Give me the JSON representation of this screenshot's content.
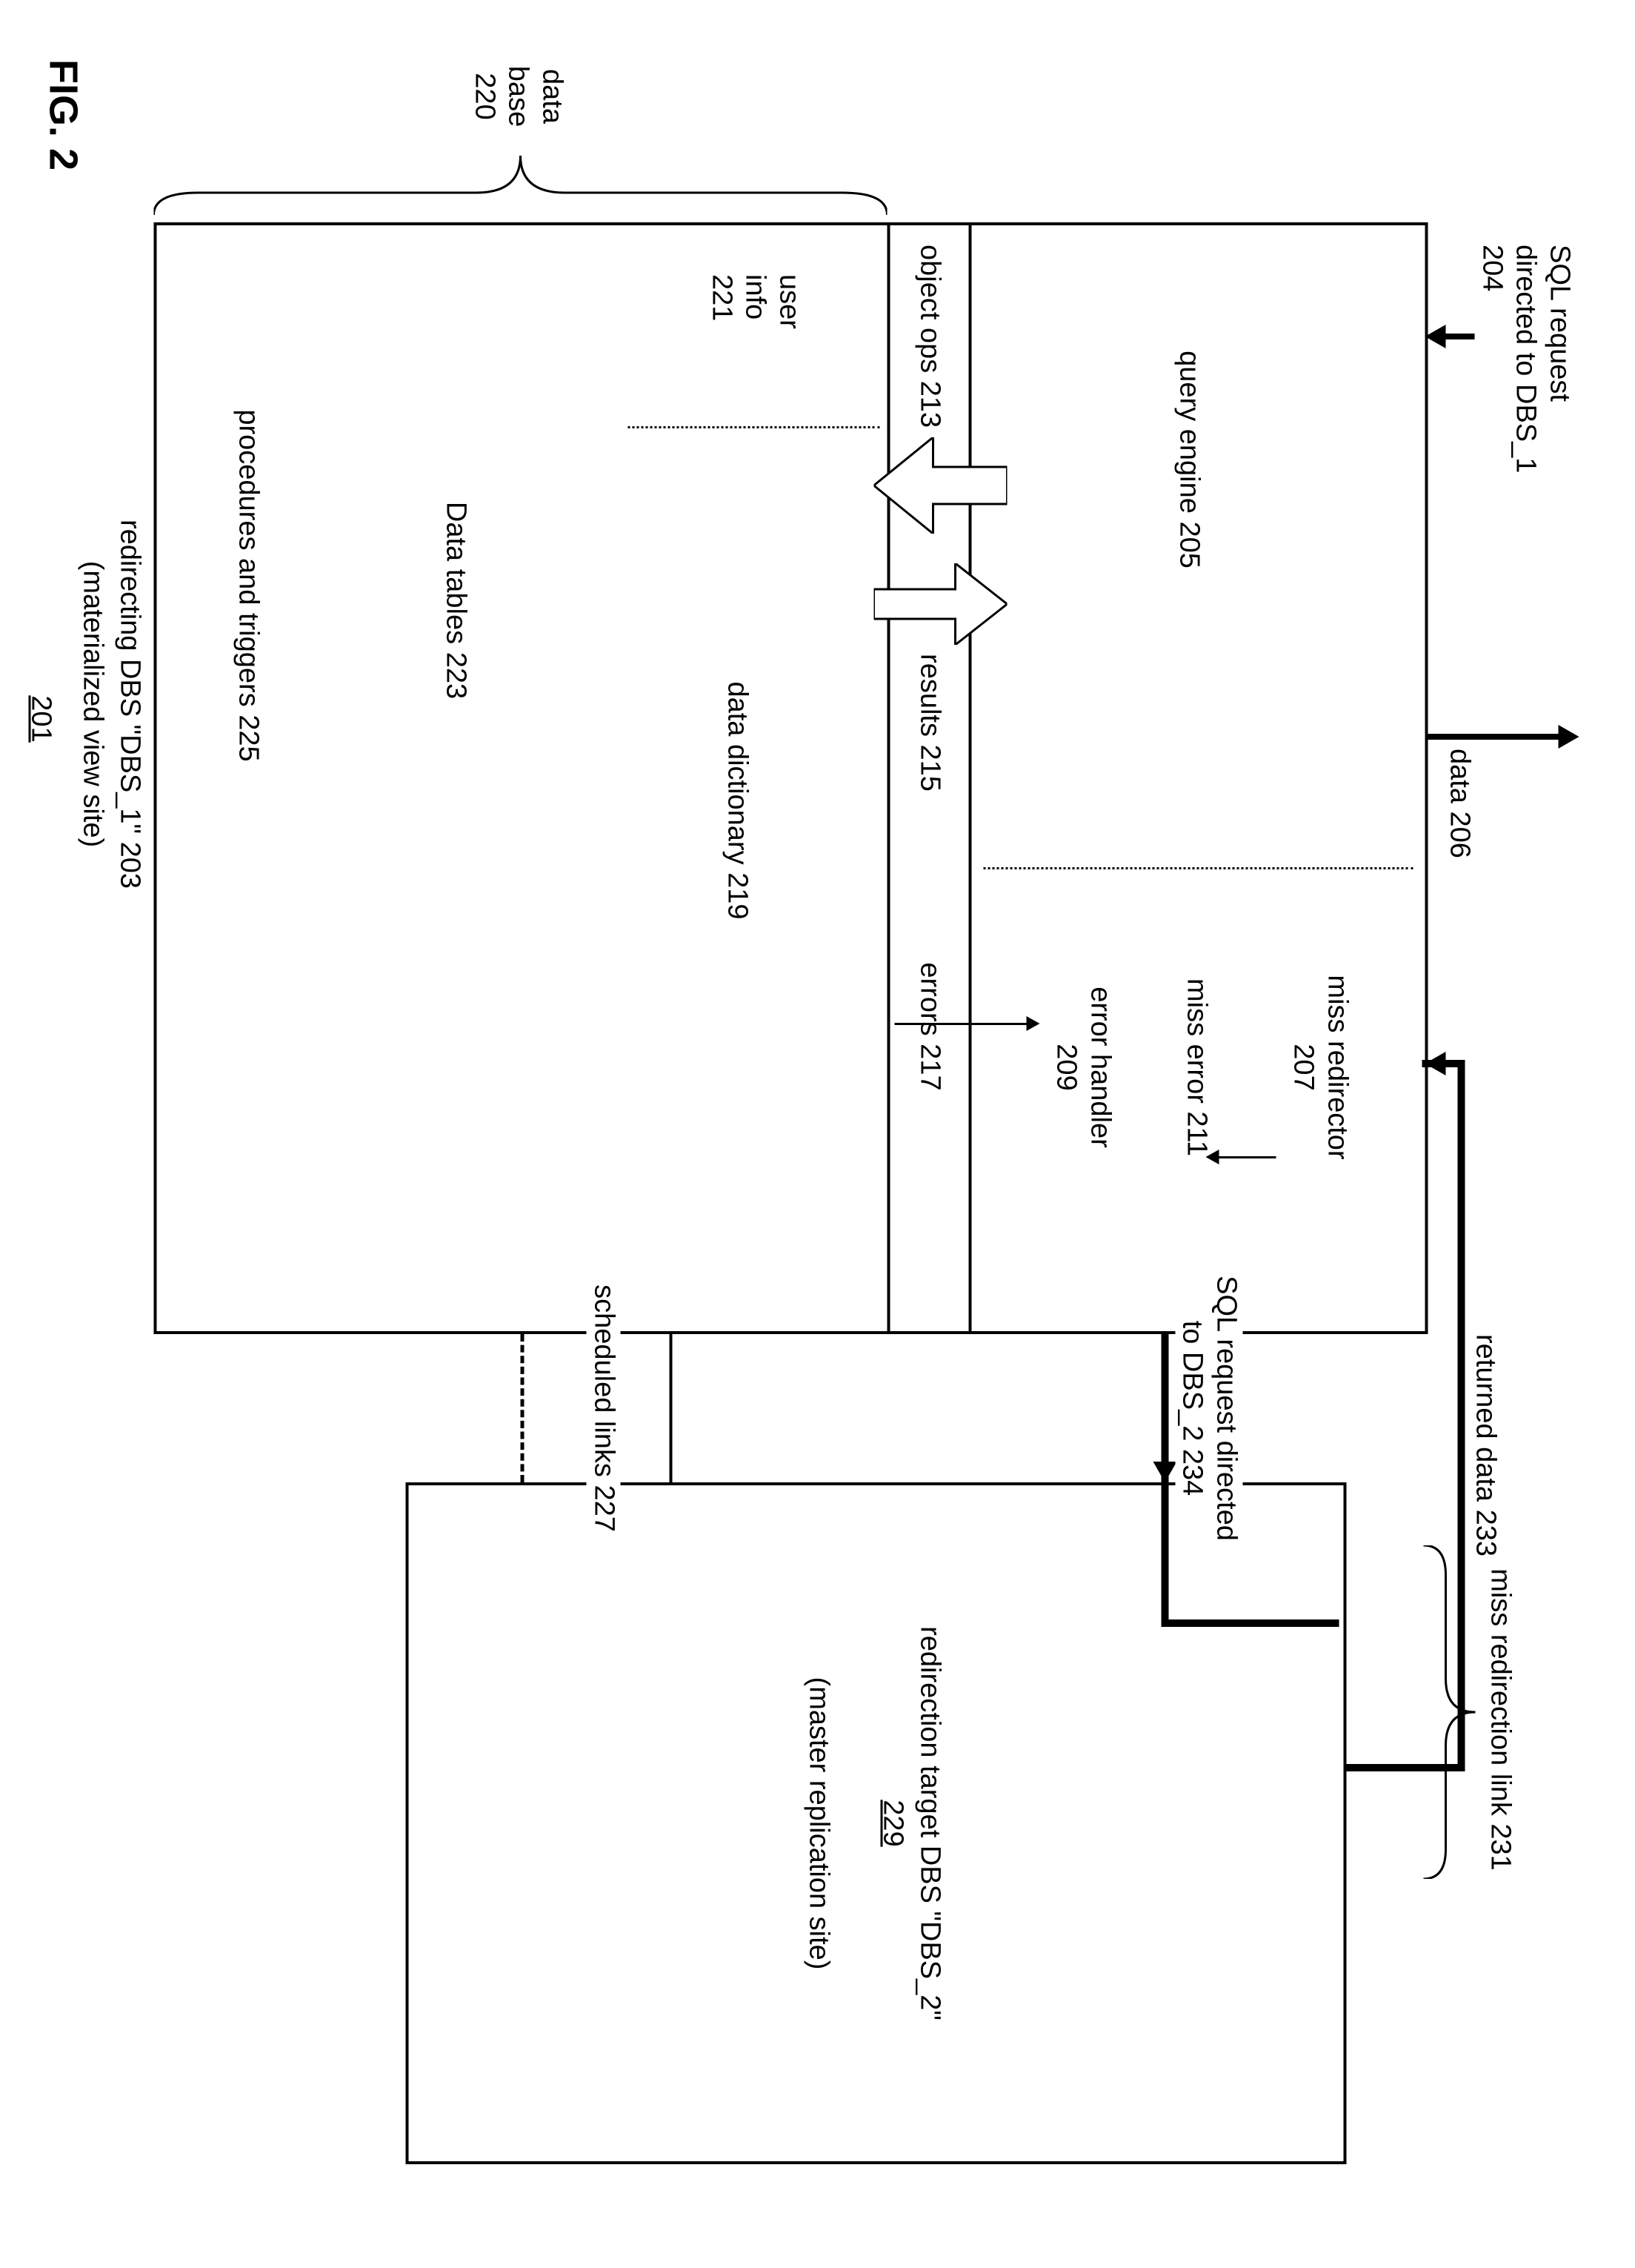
{
  "fig_label": "FIG. 2",
  "page_ref": "201",
  "dbs1": {
    "sql_in": "SQL request\ndirected to DBS_1\n204",
    "data_out": "data 206",
    "query_engine": "query engine 205",
    "miss_redirector": "miss redirector\n207",
    "error_handler": "error handler\n209",
    "miss_error": "miss error 211",
    "object_ops": "object ops 213",
    "results": "results 215",
    "errors": "errors 217",
    "data_dictionary": "data dictionary 219",
    "user_info": "user\ninfo\n221",
    "data_tables": "Data tables 223",
    "procedures": "procedures and triggers 225",
    "title": "redirecting  DBS \"DBS_1\" 203",
    "subtitle": "(materialized view site)"
  },
  "links": {
    "returned_data": "returned data 233",
    "sql_to_dbs2": "SQL request directed\nto DBS_2 234",
    "miss_link": "miss redirection link 231",
    "scheduled": "scheduled links 227"
  },
  "dbs2": {
    "line1": "redirection target DBS \"DBS_2\"",
    "line2": "229",
    "line3": "(master replication site)"
  },
  "brace_db": "data\nbase\n220"
}
